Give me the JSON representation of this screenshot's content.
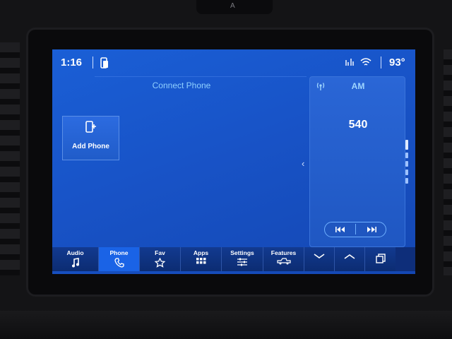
{
  "camera": {
    "symbol": "A"
  },
  "status": {
    "time": "1:16",
    "temperature": "93°",
    "icons": [
      "phone-status-icon",
      "signal-icon",
      "wifi-icon"
    ]
  },
  "phone": {
    "title": "Connect Phone",
    "add_phone_label": "Add Phone"
  },
  "radio": {
    "band": "AM",
    "frequency": "540",
    "controls": [
      "seek-back-icon",
      "seek-forward-icon"
    ]
  },
  "nav": {
    "items": [
      {
        "label": "Audio",
        "icon": "music-note-icon",
        "active": false
      },
      {
        "label": "Phone",
        "icon": "phone-icon",
        "active": true
      },
      {
        "label": "Fav",
        "icon": "star-icon",
        "active": false
      },
      {
        "label": "Apps",
        "icon": "grid-icon",
        "active": false
      },
      {
        "label": "Settings",
        "icon": "sliders-icon",
        "active": false
      },
      {
        "label": "Features",
        "icon": "truck-icon",
        "active": false
      }
    ],
    "controls": [
      "chevron-down-icon",
      "chevron-up-icon",
      "pages-icon"
    ]
  },
  "colors": {
    "screen": "#1a5fd6",
    "accent_text": "#8fd0ff",
    "nav_active": "#1a63e6"
  }
}
